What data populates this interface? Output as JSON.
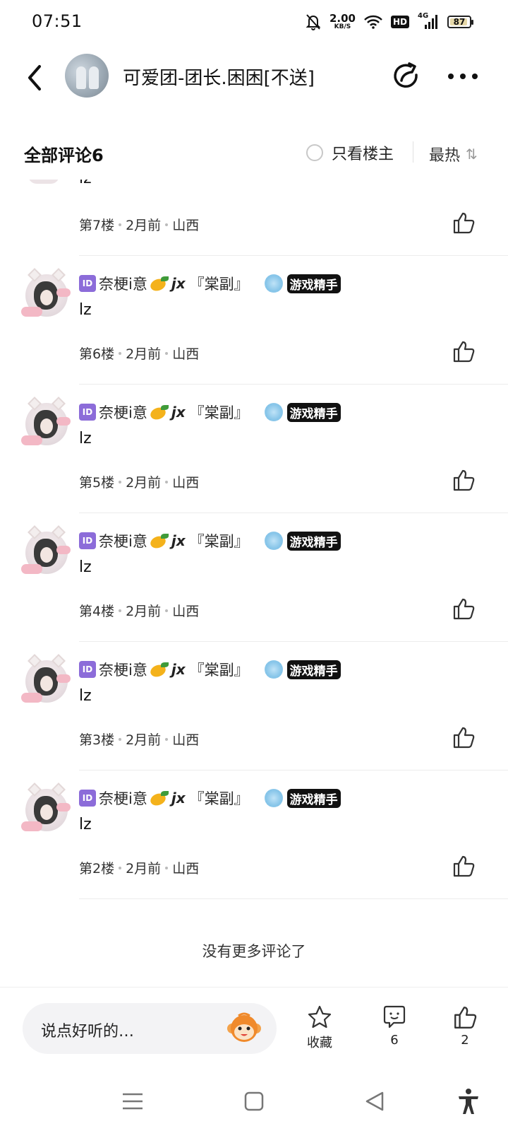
{
  "status_bar": {
    "time": "07:51",
    "net_speed": "2.00",
    "net_unit": "KB/S",
    "hd": "HD",
    "network": "4G",
    "battery": "87"
  },
  "header": {
    "title": "可爱团-团长.困困[不送]"
  },
  "sort_bar": {
    "all_comments": "全部评论6",
    "owner_only": "只看楼主",
    "sort_label": "最热",
    "sort_arrows": "⇅"
  },
  "comments": [
    {
      "text": "lz",
      "floor": "第7楼",
      "time": "2月前",
      "location": "山西"
    },
    {
      "id_badge": "ID",
      "name": "奈梗i意",
      "name_suffix_jx": "jx",
      "name_suffix": "『棠副』",
      "title_badge": "游戏精手",
      "text": "lz",
      "floor": "第6楼",
      "time": "2月前",
      "location": "山西"
    },
    {
      "id_badge": "ID",
      "name": "奈梗i意",
      "name_suffix_jx": "jx",
      "name_suffix": "『棠副』",
      "title_badge": "游戏精手",
      "text": "lz",
      "floor": "第5楼",
      "time": "2月前",
      "location": "山西"
    },
    {
      "id_badge": "ID",
      "name": "奈梗i意",
      "name_suffix_jx": "jx",
      "name_suffix": "『棠副』",
      "title_badge": "游戏精手",
      "text": "lz",
      "floor": "第4楼",
      "time": "2月前",
      "location": "山西"
    },
    {
      "id_badge": "ID",
      "name": "奈梗i意",
      "name_suffix_jx": "jx",
      "name_suffix": "『棠副』",
      "title_badge": "游戏精手",
      "text": "lz",
      "floor": "第3楼",
      "time": "2月前",
      "location": "山西"
    },
    {
      "id_badge": "ID",
      "name": "奈梗i意",
      "name_suffix_jx": "jx",
      "name_suffix": "『棠副』",
      "title_badge": "游戏精手",
      "text": "lz",
      "floor": "第2楼",
      "time": "2月前",
      "location": "山西"
    }
  ],
  "no_more": "没有更多评论了",
  "bottom_bar": {
    "input_placeholder": "说点好听的…",
    "favorite_label": "收藏",
    "comment_count": "6",
    "like_count": "2"
  },
  "colors": {
    "accent_id_badge": "#8c6cd9",
    "text_primary": "#111111",
    "divider": "#ececec"
  },
  "icons": [
    "back-icon",
    "share-icon",
    "more-icon",
    "like-icon",
    "star-icon",
    "comment-icon",
    "monkey-icon",
    "menu-icon",
    "home-icon",
    "back-triangle-icon",
    "accessibility-icon"
  ]
}
